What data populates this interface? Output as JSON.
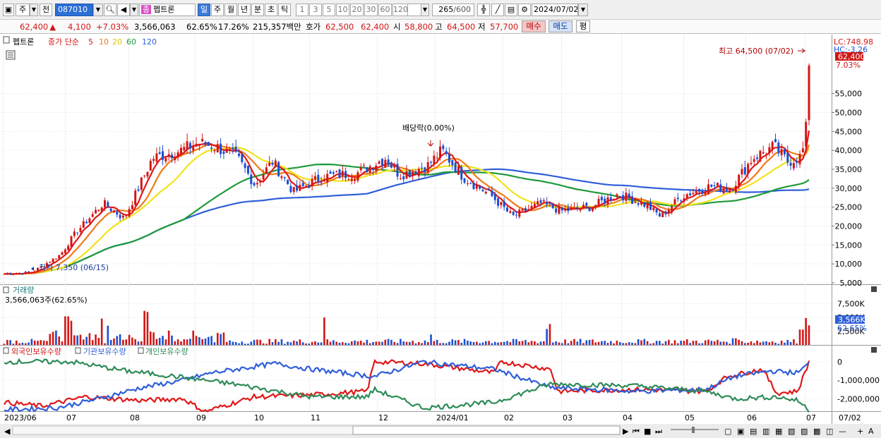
{
  "toolbar": {
    "period_label": "주",
    "prev_label": "전",
    "code": "087010",
    "stock_name": "펩트론",
    "icon_badge": "종",
    "timeframes": [
      "일",
      "주",
      "월",
      "년",
      "분",
      "초",
      "틱"
    ],
    "active_timeframe": "일",
    "intervals": [
      "1",
      "3",
      "5",
      "10",
      "20",
      "30",
      "60",
      "120"
    ],
    "count": "265",
    "count_total": "/600",
    "date": "2024/07/02"
  },
  "quote": {
    "price": "62,400",
    "change_sign": "▲",
    "change": "4,100",
    "change_pct": "+7.03%",
    "volume": "3,566,063",
    "volume_ratio": "62.65%",
    "turnover_pct": "17.26%",
    "amount": "215,357백만",
    "bid_label": "호가",
    "bid1": "62,500",
    "bid2": "62,400",
    "open_label": "시",
    "open": "58,800",
    "high_label": "고",
    "high": "64,500",
    "low_label": "저",
    "low": "57,700",
    "buy_label": "매수",
    "sell_label": "매도",
    "avg_label": "평"
  },
  "main_panel": {
    "title": "펩트론",
    "indicator": "종가 단순",
    "ma_labels": [
      {
        "text": "5",
        "color": "#e01818"
      },
      {
        "text": "10",
        "color": "#f07a18"
      },
      {
        "text": "20",
        "color": "#e6c400"
      },
      {
        "text": "60",
        "color": "#1f9a3a"
      },
      {
        "text": "120",
        "color": "#2f5fd8"
      }
    ],
    "lc": "LC:748.98",
    "hc": "HC:-3.26",
    "price_badge": "62,400",
    "pct_badge": "7.03%",
    "y_ticks": [
      "55,000",
      "50,000",
      "45,000",
      "40,000",
      "35,000",
      "30,000",
      "25,000",
      "20,000",
      "15,000",
      "10,000",
      "5,000"
    ],
    "annotations": {
      "high": "최고 64,500 (07/02)",
      "low": "최저 7,350 (06/15)",
      "dividend": "배당락(0.00%)"
    }
  },
  "volume_panel": {
    "title": "거래량",
    "current": "3,566,063주(62.65%)",
    "y_ticks": [
      "7,500K",
      "5,000K",
      "2,500K"
    ],
    "badge": "3,566K",
    "badge_pct": "62.65%"
  },
  "holdings_panel": {
    "labels": [
      "외국인보유수량",
      "기관보유수량",
      "개인보유수량"
    ],
    "y_ticks": [
      "0",
      "-1,000,000",
      "-2,000,000"
    ]
  },
  "x_axis": {
    "labels": [
      "2023/06",
      "07",
      "08",
      "09",
      "10",
      "11",
      "12",
      "2024/01",
      "02",
      "03",
      "04",
      "05",
      "06",
      "07"
    ],
    "right_label": "07/02"
  },
  "colors": {
    "up": "#d21616",
    "down": "#1a4fd2",
    "ma5": "#e01818",
    "ma10": "#f07a18",
    "ma20": "#f2e21a",
    "ma60": "#1f9a3a",
    "ma120": "#2f5fd8",
    "foreign": "#e01818",
    "institution": "#2f5fd8",
    "individual": "#2e8b57"
  },
  "chart_data": {
    "type": "line",
    "title": "펩트론",
    "x": [
      "2023/06",
      "07",
      "08",
      "09",
      "10",
      "11",
      "12",
      "2024/01",
      "02",
      "03",
      "04",
      "05",
      "06",
      "07"
    ],
    "series": [
      {
        "name": "5",
        "values": [
          7350,
          12500,
          25000,
          41000,
          30500,
          28500,
          32000,
          37000,
          24000,
          25000,
          24500,
          29500,
          40000,
          62400
        ]
      },
      {
        "name": "120",
        "values": [
          7500,
          9000,
          12500,
          17500,
          21000,
          24500,
          28500,
          32000,
          33500,
          32500,
          30000,
          29000,
          29500,
          30200
        ]
      }
    ],
    "ylim": [
      5000,
      65000
    ]
  }
}
